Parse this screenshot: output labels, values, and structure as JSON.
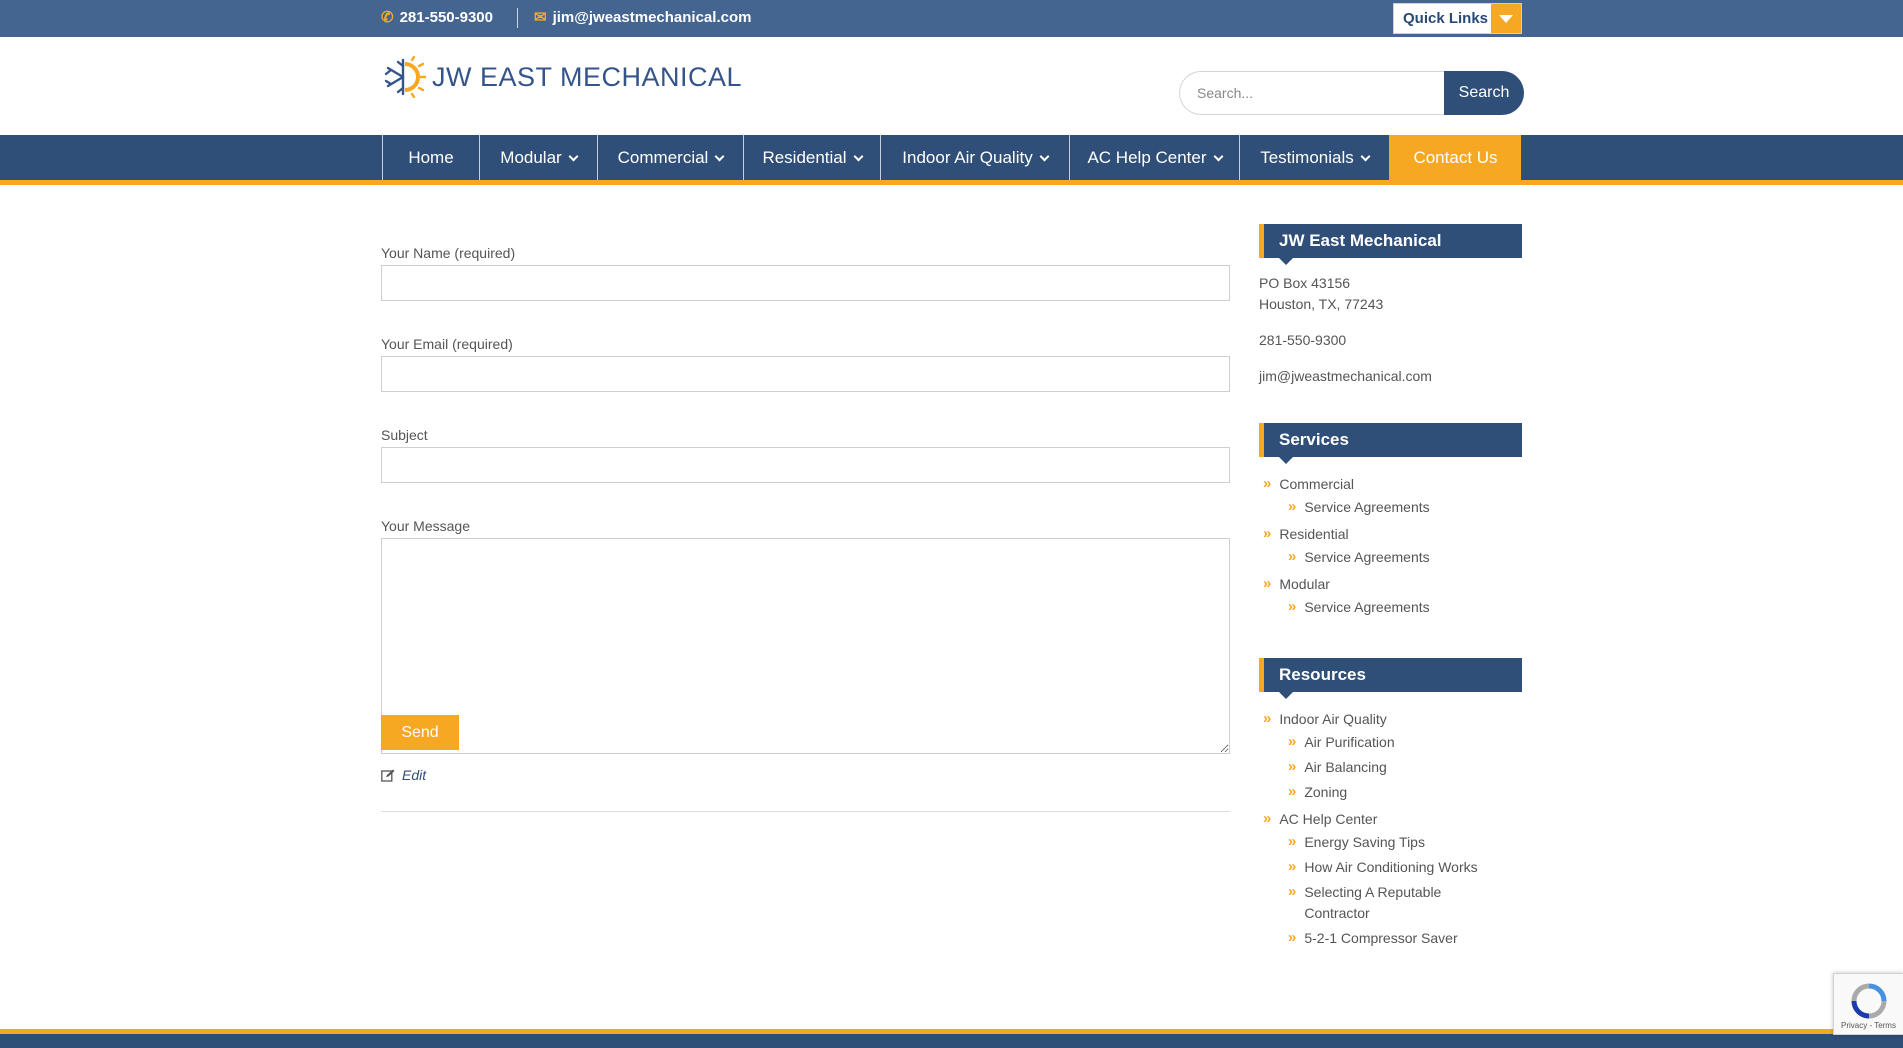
{
  "topbar": {
    "phone": "281-550-9300",
    "email": "jim@jweastmechanical.com",
    "quick_links": "Quick Links"
  },
  "header": {
    "logo_text": "JW EAST MECHANICAL",
    "search_placeholder": "Search...",
    "search_button": "Search"
  },
  "nav": {
    "items": [
      {
        "label": "Home"
      },
      {
        "label": "Modular"
      },
      {
        "label": "Commercial"
      },
      {
        "label": "Residential"
      },
      {
        "label": "Indoor Air Quality"
      },
      {
        "label": "AC Help Center"
      },
      {
        "label": "Testimonials"
      },
      {
        "label": "Contact Us"
      }
    ]
  },
  "form": {
    "name_label": "Your Name (required)",
    "email_label": "Your Email (required)",
    "subject_label": "Subject",
    "message_label": "Your Message",
    "send_label": "Send",
    "edit_label": "Edit"
  },
  "sidebar": {
    "company": {
      "title": "JW East Mechanical",
      "address_line1": "PO Box 43156",
      "address_line2": "Houston, TX, 77243",
      "phone": "281-550-9300",
      "email": "jim@jweastmechanical.com"
    },
    "services": {
      "title": "Services",
      "items": [
        {
          "label": "Commercial",
          "sub": "Service Agreements"
        },
        {
          "label": "Residential",
          "sub": "Service Agreements"
        },
        {
          "label": "Modular",
          "sub": "Service Agreements"
        }
      ]
    },
    "resources": {
      "title": "Resources",
      "indoor_air_quality": "Indoor Air Quality",
      "iaq_subs": [
        "Air Purification",
        "Air Balancing",
        "Zoning"
      ],
      "ac_help_center": "AC Help Center",
      "ac_subs": [
        "Energy Saving Tips",
        "How Air Conditioning Works",
        "Selecting A Reputable Contractor",
        "5-2-1 Compressor Saver"
      ]
    }
  },
  "recaptcha": {
    "links": "Privacy - Terms"
  },
  "colors": {
    "primary": "#2f4e78",
    "topbar": "#456591",
    "accent": "#f7a823"
  }
}
